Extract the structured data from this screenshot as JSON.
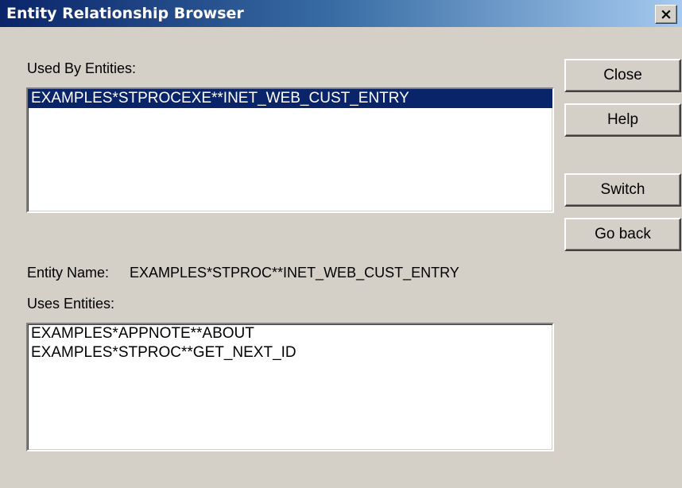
{
  "window": {
    "title": "Entity Relationship Browser",
    "close_glyph": "×"
  },
  "used_by": {
    "label": "Used By Entities:",
    "items": [
      {
        "text": "EXAMPLES*STPROCEXE**INET_WEB_CUST_ENTRY",
        "selected": true
      }
    ]
  },
  "entity_name": {
    "label": "Entity Name:",
    "value": "EXAMPLES*STPROC**INET_WEB_CUST_ENTRY"
  },
  "uses": {
    "label": "Uses Entities:",
    "items": [
      {
        "text": "EXAMPLES*APPNOTE**ABOUT",
        "selected": false
      },
      {
        "text": "EXAMPLES*STPROC**GET_NEXT_ID",
        "selected": false
      }
    ]
  },
  "buttons": {
    "close": "Close",
    "help": "Help",
    "switch": "Switch",
    "go_back": "Go back"
  }
}
